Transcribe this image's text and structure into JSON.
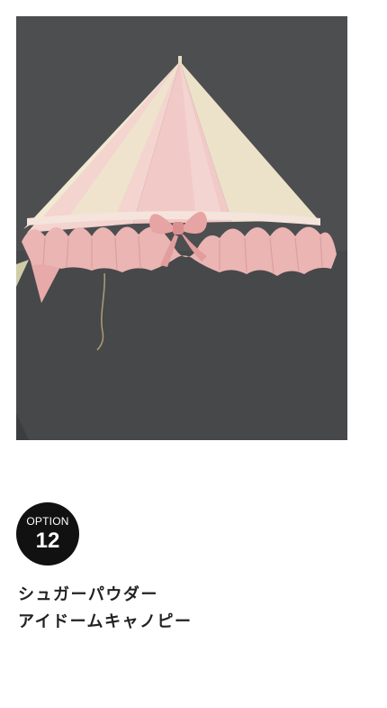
{
  "option_badge": {
    "label": "OPTION",
    "number": "12"
  },
  "product": {
    "title_line1": "シュガーパウダー",
    "title_line2": "アイドームキャノピー"
  },
  "colors": {
    "wall": "#4c4d4f",
    "canopy_pink": "#f0c2c0",
    "canopy_cream": "#f1ead6",
    "ruffle_pink": "#eab1b0",
    "badge": "#111111",
    "title_text": "#222222"
  }
}
